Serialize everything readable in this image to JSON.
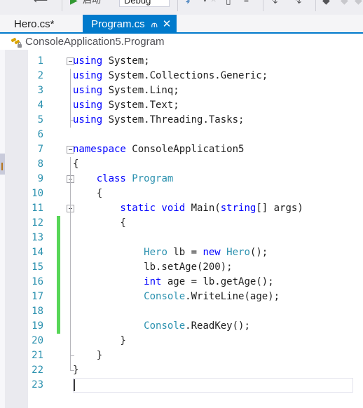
{
  "toolbar": {
    "back_arrow_icon": "back-arrow-icon",
    "run_icon": "run-play-icon",
    "run_label": "启动",
    "config_value": "Debug",
    "glyphs": [
      {
        "name": "find-icon",
        "glyph": "⌕"
      },
      {
        "name": "step-down-icon",
        "glyph": "▼"
      },
      {
        "name": "step-over-icon",
        "glyph": "⨯"
      },
      {
        "name": "window-icon",
        "glyph": "▣"
      },
      {
        "name": "list-icon",
        "glyph": "≡"
      },
      {
        "name": "pin-left-icon",
        "glyph": "↑"
      },
      {
        "name": "pin-right-icon",
        "glyph": "↑"
      },
      {
        "name": "bookmark-icon",
        "glyph": "⚑"
      },
      {
        "name": "bookmark-prev-icon",
        "glyph": "⚑"
      },
      {
        "name": "bookmark-next-icon",
        "glyph": "⚑"
      }
    ]
  },
  "tabs": {
    "inactive": {
      "label": "Hero.cs*",
      "dirty": true
    },
    "active": {
      "label": "Program.cs",
      "pin_icon": "⫙",
      "close_icon": "✕"
    }
  },
  "navbar": {
    "icon": "class-member-locked-icon",
    "text": "ConsoleApplication5.Program"
  },
  "editor": {
    "cursor_line": 23,
    "change_bar_color": "#57d657",
    "line_number_color": "#2b91af",
    "keyword_color": "#0000ff",
    "type_color": "#2b91af",
    "text_color": "#1e1e1e",
    "lines": [
      {
        "n": 1,
        "fold": "open",
        "bar": null,
        "tokens": [
          {
            "t": "using ",
            "c": "kw"
          },
          {
            "t": "System;",
            "c": "pln"
          }
        ]
      },
      {
        "n": 2,
        "fold": null,
        "bar": "line",
        "tokens": [
          {
            "t": "using ",
            "c": "kw"
          },
          {
            "t": "System.Collections.Generic;",
            "c": "pln"
          }
        ]
      },
      {
        "n": 3,
        "fold": null,
        "bar": "line",
        "tokens": [
          {
            "t": "using ",
            "c": "kw"
          },
          {
            "t": "System.Linq;",
            "c": "pln"
          }
        ]
      },
      {
        "n": 4,
        "fold": null,
        "bar": "line",
        "tokens": [
          {
            "t": "using ",
            "c": "kw"
          },
          {
            "t": "System.Text;",
            "c": "pln"
          }
        ]
      },
      {
        "n": 5,
        "fold": null,
        "bar": "end",
        "tokens": [
          {
            "t": "using ",
            "c": "kw"
          },
          {
            "t": "System.Threading.Tasks;",
            "c": "pln"
          }
        ]
      },
      {
        "n": 6,
        "fold": null,
        "bar": null,
        "tokens": []
      },
      {
        "n": 7,
        "fold": "open",
        "bar": null,
        "tokens": [
          {
            "t": "namespace ",
            "c": "kw"
          },
          {
            "t": "ConsoleApplication5",
            "c": "pln"
          }
        ]
      },
      {
        "n": 8,
        "fold": null,
        "bar": "line2",
        "tokens": [
          {
            "t": "{",
            "c": "pln"
          }
        ]
      },
      {
        "n": 9,
        "fold": "open",
        "bar": "line2",
        "tokens": [
          {
            "t": "    class ",
            "c": "kw"
          },
          {
            "t": "Program",
            "c": "typ"
          }
        ]
      },
      {
        "n": 10,
        "fold": null,
        "bar": "both",
        "tokens": [
          {
            "t": "    {",
            "c": "pln"
          }
        ]
      },
      {
        "n": 11,
        "fold": "open",
        "bar": "line2",
        "tokens": [
          {
            "t": "        static void ",
            "c": "kw"
          },
          {
            "t": "Main(",
            "c": "pln"
          },
          {
            "t": "string",
            "c": "kw"
          },
          {
            "t": "[] args)",
            "c": "pln"
          }
        ]
      },
      {
        "n": 12,
        "fold": null,
        "bar": "both",
        "change": true,
        "tokens": [
          {
            "t": "        {",
            "c": "pln"
          }
        ]
      },
      {
        "n": 13,
        "fold": null,
        "bar": "both",
        "change": true,
        "tokens": []
      },
      {
        "n": 14,
        "fold": null,
        "bar": "both",
        "change": true,
        "tokens": [
          {
            "t": "            ",
            "c": "pln"
          },
          {
            "t": "Hero",
            "c": "typ"
          },
          {
            "t": " lb = ",
            "c": "pln"
          },
          {
            "t": "new ",
            "c": "kw"
          },
          {
            "t": "Hero",
            "c": "typ"
          },
          {
            "t": "();",
            "c": "pln"
          }
        ]
      },
      {
        "n": 15,
        "fold": null,
        "bar": "both",
        "change": true,
        "tokens": [
          {
            "t": "            lb.setAge(200);",
            "c": "pln"
          }
        ]
      },
      {
        "n": 16,
        "fold": null,
        "bar": "both",
        "change": true,
        "tokens": [
          {
            "t": "            ",
            "c": "pln"
          },
          {
            "t": "int",
            "c": "kw"
          },
          {
            "t": " age = lb.getAge();",
            "c": "pln"
          }
        ]
      },
      {
        "n": 17,
        "fold": null,
        "bar": "both",
        "change": true,
        "tokens": [
          {
            "t": "            ",
            "c": "pln"
          },
          {
            "t": "Console",
            "c": "typ"
          },
          {
            "t": ".WriteLine(age);",
            "c": "pln"
          }
        ]
      },
      {
        "n": 18,
        "fold": null,
        "bar": "both",
        "change": true,
        "tokens": []
      },
      {
        "n": 19,
        "fold": null,
        "bar": "both",
        "change": true,
        "tokens": [
          {
            "t": "            ",
            "c": "pln"
          },
          {
            "t": "Console",
            "c": "typ"
          },
          {
            "t": ".ReadKey();",
            "c": "pln"
          }
        ]
      },
      {
        "n": 20,
        "fold": null,
        "bar": "both",
        "tokens": [
          {
            "t": "        }",
            "c": "pln"
          }
        ]
      },
      {
        "n": 21,
        "fold": null,
        "bar": "tick",
        "tokens": [
          {
            "t": "    }",
            "c": "pln"
          }
        ]
      },
      {
        "n": 22,
        "fold": null,
        "bar": "vend",
        "tokens": [
          {
            "t": "}",
            "c": "pln"
          }
        ]
      },
      {
        "n": 23,
        "fold": null,
        "bar": null,
        "current": true,
        "tokens": []
      }
    ]
  }
}
